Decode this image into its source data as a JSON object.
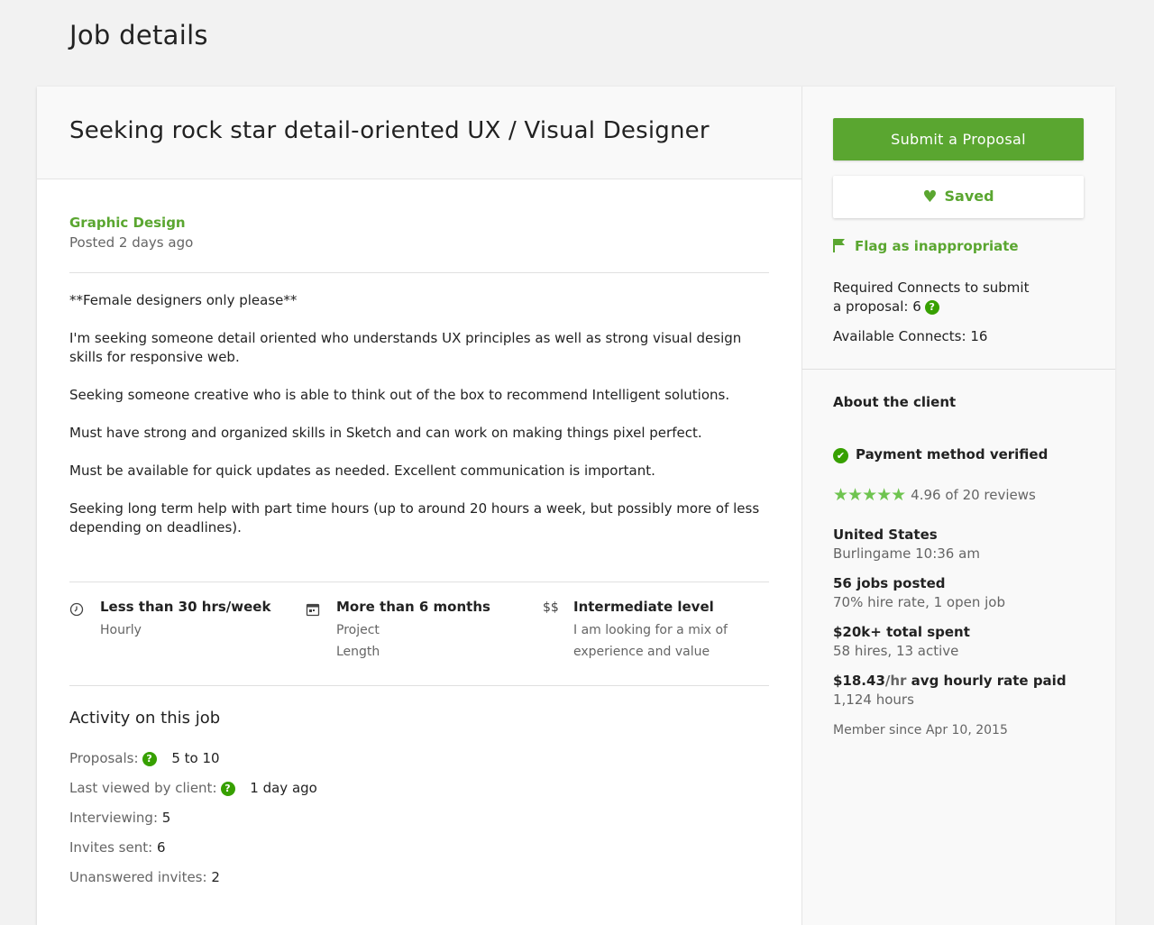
{
  "page": {
    "title": "Job details"
  },
  "job": {
    "title": "Seeking rock star detail-oriented UX / Visual Designer",
    "category": "Graphic Design",
    "posted": "Posted 2 days ago",
    "description": [
      "**Female designers only please**",
      "I'm seeking someone detail oriented who understands UX principles as well as strong visual design skills for responsive web.",
      "Seeking someone creative who is able to think out of the box to recommend Intelligent solutions.",
      "Must have strong and organized skills in Sketch and can work on making things pixel perfect.",
      "Must be available for quick updates as needed. Excellent communication is important.",
      "Seeking long term help with part time hours (up to around 20 hours a week, but possibly more of less depending on deadlines)."
    ],
    "features": [
      {
        "icon": "clock-icon",
        "title": "Less than 30 hrs/week",
        "subtitle": "Hourly"
      },
      {
        "icon": "calendar-icon",
        "title": "More than 6 months",
        "subtitle": "Project Length"
      },
      {
        "icon": "dollar-icon",
        "title": "Intermediate level",
        "subtitle": "I am looking for a mix of experience and value"
      }
    ],
    "feature_icon_glyphs": {
      "dollar": "$$"
    }
  },
  "activity": {
    "title": "Activity on this job",
    "proposals_label": "Proposals:",
    "proposals_value": "5 to 10",
    "last_viewed_label": "Last viewed by client:",
    "last_viewed_value": "1 day ago",
    "interviewing_label": "Interviewing:",
    "interviewing_value": "5",
    "invites_label": "Invites sent:",
    "invites_value": "6",
    "unanswered_label": "Unanswered invites:",
    "unanswered_value": "2",
    "help_glyph": "?"
  },
  "sidebar": {
    "submit_label": "Submit a Proposal",
    "saved_label": "Saved",
    "flag_label": "Flag as inappropriate",
    "connects_required_line1": "Required Connects to submit",
    "connects_required_line2": "a proposal: 6",
    "connects_available": "Available Connects: 16",
    "heart_glyph": "♥"
  },
  "client": {
    "title": "About the client",
    "payment_verified": "Payment method verified",
    "check_glyph": "✔",
    "stars_glyph": "★★★★★",
    "rating_text": "4.96 of 20 reviews",
    "rating": 4.96,
    "country": "United States",
    "location": "Burlingame 10:36 am",
    "jobs_posted": "56 jobs posted",
    "hire_rate": "70% hire rate, 1 open job",
    "total_spent": "$20k+ total spent",
    "hires": "58 hires, 13 active",
    "avg_rate_value": "$18.43",
    "avg_rate_unit": "/hr",
    "avg_rate_suffix": " avg hourly rate paid",
    "hours": "1,124 hours",
    "member_since": "Member since Apr 10, 2015"
  },
  "colors": {
    "accent": "#5aa630",
    "verified": "#37a000",
    "star": "#6fc450"
  }
}
